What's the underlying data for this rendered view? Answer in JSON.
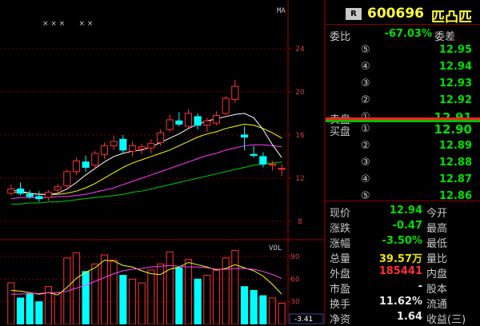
{
  "chart_data": {
    "type": "candlestick",
    "price_axis": {
      "ticks": [
        24,
        20,
        16,
        12,
        8
      ],
      "ylim": [
        6.3,
        28.5
      ]
    },
    "volume_axis": {
      "ticks": [
        90,
        60,
        30
      ],
      "ylim": [
        0,
        110
      ]
    },
    "indicator_labels": {
      "main": "MA",
      "volume": "VOL"
    },
    "indicator_marks": "× × ×      × ×",
    "readout": "-3.41",
    "candles": [
      {
        "o": 10.6,
        "h": 11.4,
        "l": 10.4,
        "c": 11.0
      },
      {
        "o": 11.0,
        "h": 11.6,
        "l": 10.4,
        "c": 10.6
      },
      {
        "o": 10.5,
        "h": 10.9,
        "l": 10.1,
        "c": 10.3
      },
      {
        "o": 10.3,
        "h": 10.8,
        "l": 9.8,
        "c": 10.1
      },
      {
        "o": 10.2,
        "h": 10.9,
        "l": 9.9,
        "c": 10.7
      },
      {
        "o": 10.9,
        "h": 11.5,
        "l": 10.5,
        "c": 11.2
      },
      {
        "o": 11.3,
        "h": 12.8,
        "l": 11.0,
        "c": 12.6
      },
      {
        "o": 12.6,
        "h": 13.9,
        "l": 12.3,
        "c": 13.6
      },
      {
        "o": 13.5,
        "h": 14.1,
        "l": 12.6,
        "c": 13.0
      },
      {
        "o": 13.2,
        "h": 14.5,
        "l": 12.8,
        "c": 14.3
      },
      {
        "o": 14.2,
        "h": 15.3,
        "l": 13.8,
        "c": 15.0
      },
      {
        "o": 15.0,
        "h": 15.9,
        "l": 14.6,
        "c": 15.4
      },
      {
        "o": 15.6,
        "h": 16.0,
        "l": 14.3,
        "c": 14.6
      },
      {
        "o": 14.5,
        "h": 15.4,
        "l": 14.0,
        "c": 15.0
      },
      {
        "o": 14.7,
        "h": 15.2,
        "l": 14.2,
        "c": 14.9
      },
      {
        "o": 14.8,
        "h": 15.6,
        "l": 14.3,
        "c": 15.2
      },
      {
        "o": 15.3,
        "h": 16.5,
        "l": 15.0,
        "c": 16.2
      },
      {
        "o": 16.5,
        "h": 17.9,
        "l": 16.3,
        "c": 17.4
      },
      {
        "o": 17.3,
        "h": 18.1,
        "l": 16.8,
        "c": 17.0
      },
      {
        "o": 16.8,
        "h": 18.4,
        "l": 16.6,
        "c": 18.0
      },
      {
        "o": 17.7,
        "h": 18.0,
        "l": 16.5,
        "c": 16.9
      },
      {
        "o": 16.9,
        "h": 17.6,
        "l": 16.3,
        "c": 17.3
      },
      {
        "o": 17.1,
        "h": 18.2,
        "l": 16.9,
        "c": 17.8
      },
      {
        "o": 18.0,
        "h": 19.6,
        "l": 17.8,
        "c": 19.4
      },
      {
        "o": 19.3,
        "h": 21.1,
        "l": 19.0,
        "c": 20.5
      },
      {
        "o": 16.0,
        "h": 16.8,
        "l": 14.6,
        "c": 15.8
      },
      {
        "o": 14.2,
        "h": 15.0,
        "l": 13.9,
        "c": 14.1
      },
      {
        "o": 14.0,
        "h": 14.4,
        "l": 13.0,
        "c": 13.3
      },
      {
        "o": 13.2,
        "h": 13.6,
        "l": 12.7,
        "c": 13.3
      },
      {
        "o": 12.9,
        "h": 13.3,
        "l": 12.2,
        "c": 12.9
      }
    ],
    "ma5": [
      10.9,
      10.8,
      10.6,
      10.5,
      10.5,
      10.6,
      11.0,
      11.6,
      12.3,
      12.9,
      13.5,
      14.0,
      14.3,
      14.5,
      14.6,
      14.9,
      15.3,
      15.7,
      16.1,
      16.6,
      17.0,
      17.3,
      17.5,
      17.7,
      17.9,
      18.0,
      17.6,
      16.5,
      15.1,
      13.9
    ],
    "ma10": [
      10.7,
      10.7,
      10.6,
      10.5,
      10.5,
      10.5,
      10.6,
      10.8,
      11.1,
      11.5,
      12.0,
      12.5,
      13.0,
      13.4,
      13.7,
      14.0,
      14.3,
      14.6,
      15.0,
      15.4,
      15.8,
      16.1,
      16.3,
      16.6,
      16.8,
      17.0,
      16.9,
      16.6,
      16.2,
      15.7
    ],
    "ma20": [
      10.1,
      10.2,
      10.2,
      10.2,
      10.2,
      10.3,
      10.3,
      10.4,
      10.5,
      10.7,
      10.9,
      11.1,
      11.4,
      11.7,
      12.0,
      12.3,
      12.6,
      12.9,
      13.2,
      13.5,
      13.8,
      14.1,
      14.3,
      14.6,
      14.8,
      15.0,
      15.1,
      15.1,
      15.0,
      14.9
    ],
    "ma60": [
      9.6,
      9.6,
      9.7,
      9.7,
      9.8,
      9.8,
      9.9,
      10.0,
      10.1,
      10.2,
      10.3,
      10.4,
      10.5,
      10.7,
      10.8,
      11.0,
      11.2,
      11.4,
      11.6,
      11.8,
      12.0,
      12.2,
      12.4,
      12.6,
      12.8,
      13.0,
      13.2,
      13.3,
      13.4,
      13.5
    ],
    "volume": [
      55,
      35,
      40,
      30,
      50,
      42,
      88,
      95,
      70,
      80,
      92,
      85,
      65,
      60,
      55,
      72,
      80,
      96,
      75,
      86,
      60,
      65,
      72,
      88,
      98,
      50,
      45,
      38,
      35,
      28
    ],
    "vol_ma5": [
      45,
      44,
      42,
      40,
      42,
      39,
      49,
      61,
      69,
      75,
      85,
      84,
      78,
      76,
      71,
      67,
      66,
      73,
      76,
      82,
      79,
      76,
      72,
      74,
      79,
      75,
      71,
      64,
      53,
      40
    ],
    "vol_ma10": [
      40,
      40,
      41,
      41,
      42,
      42,
      44,
      48,
      52,
      57,
      62,
      67,
      71,
      73,
      74,
      76,
      77,
      78,
      77,
      76,
      76,
      75,
      73,
      73,
      74,
      74,
      73,
      70,
      66,
      61
    ]
  },
  "colors": {
    "up": "#ff3333",
    "down": "#00ffff",
    "ma5": "#ffffff",
    "ma10": "#ffff00",
    "ma20": "#ff40ff",
    "ma60": "#00d000",
    "grid": "#800000",
    "axis": "#a00000"
  },
  "quote": {
    "badge": "R",
    "code": "600696",
    "name": "匹凸匹",
    "weibi_label": "委比",
    "weibi_value": "-67.03%",
    "weicha_label": "委差",
    "sell_label": "卖盘",
    "buy_label": "买盘",
    "asks": [
      {
        "no": "⑤",
        "price": "12.95"
      },
      {
        "no": "④",
        "price": "12.94"
      },
      {
        "no": "③",
        "price": "12.93"
      },
      {
        "no": "②",
        "price": "12.92"
      },
      {
        "no": "①",
        "price": "12.91"
      }
    ],
    "bids": [
      {
        "no": "①",
        "price": "12.90"
      },
      {
        "no": "②",
        "price": "12.89"
      },
      {
        "no": "③",
        "price": "12.88"
      },
      {
        "no": "④",
        "price": "12.87"
      },
      {
        "no": "⑤",
        "price": "12.86"
      }
    ],
    "stats": [
      {
        "label": "现价",
        "value": "12.94",
        "label2": "今开"
      },
      {
        "label": "涨跌",
        "value": "-0.47",
        "label2": "最高"
      },
      {
        "label": "涨幅",
        "value": "-3.50%",
        "label2": "最低"
      },
      {
        "label": "总量",
        "value": "39.57万",
        "label2": "量比"
      },
      {
        "label": "外盘",
        "value": "185441",
        "label2": "内盘"
      },
      {
        "label": "市盈",
        "value": "-",
        "label2": "股本"
      },
      {
        "label": "换手",
        "value": "11.62%",
        "label2": "流通"
      },
      {
        "label": "净资",
        "value": "1.64",
        "label2": "收益(三)"
      }
    ]
  }
}
